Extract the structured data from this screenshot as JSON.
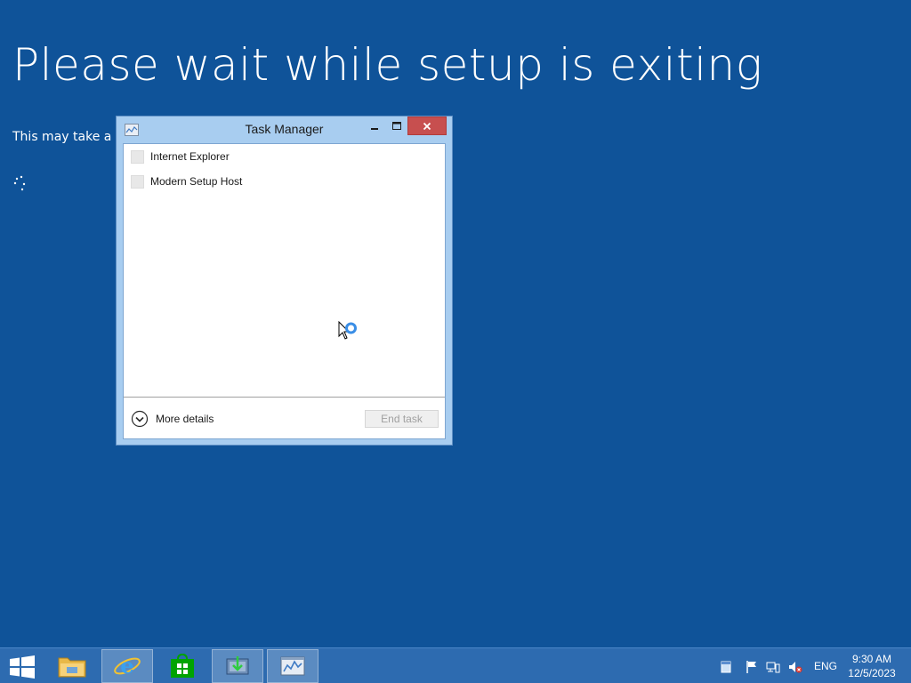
{
  "setup": {
    "title": "Please wait while setup is exiting",
    "subtitle": "This may take a fe"
  },
  "task_manager": {
    "title": "Task Manager",
    "apps": [
      {
        "label": "Internet Explorer"
      },
      {
        "label": "Modern Setup Host"
      }
    ],
    "more_details_label": "More details",
    "end_task_label": "End task"
  },
  "taskbar": {
    "pinned": [
      "file-explorer-icon",
      "internet-explorer-icon",
      "store-icon",
      "setup-icon",
      "task-manager-icon"
    ],
    "tray": {
      "language": "ENG",
      "time": "9:30 AM",
      "date": "12/5/2023"
    }
  },
  "colors": {
    "background": "#0f5399",
    "taskbar": "#2d6bb0",
    "window_frame": "#a8cdf0",
    "close_button": "#c74f4f"
  }
}
